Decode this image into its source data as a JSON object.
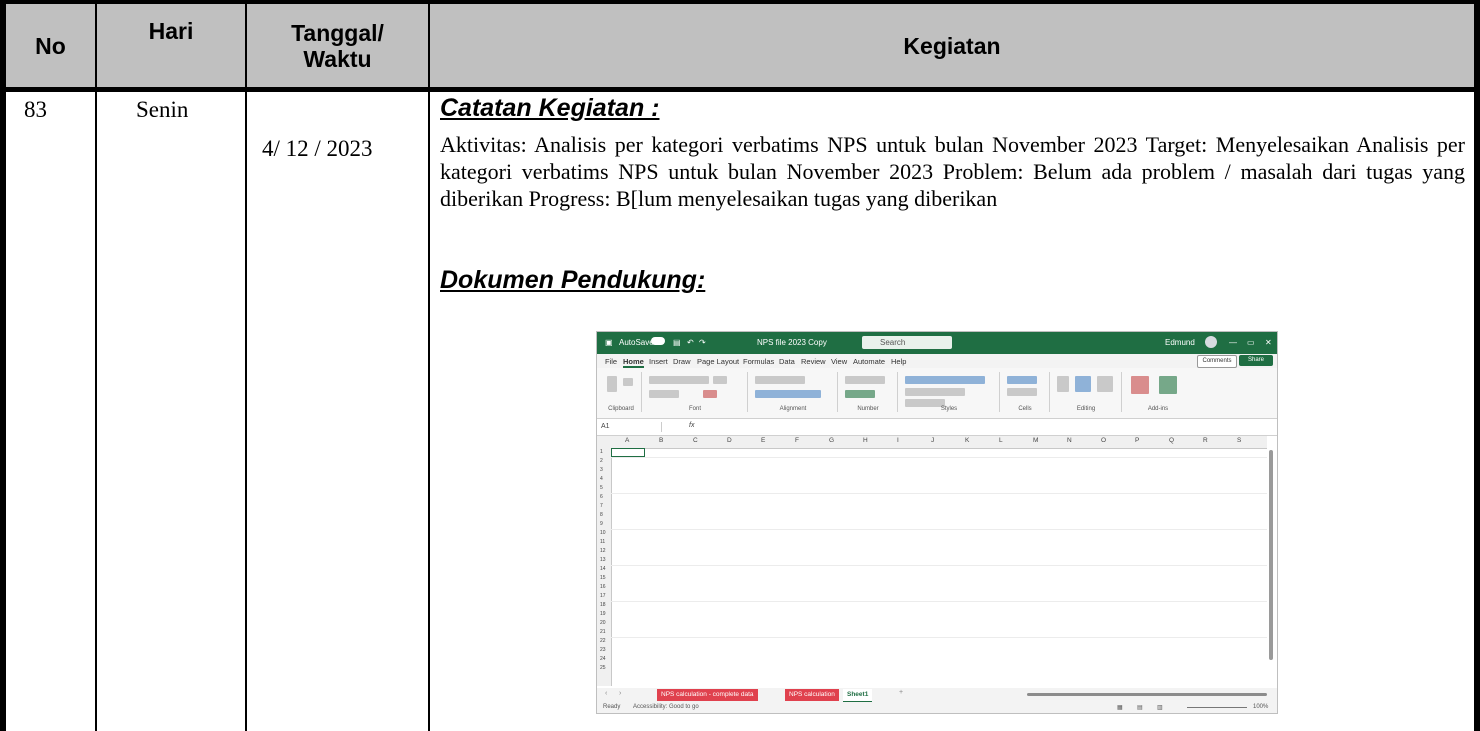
{
  "header": {
    "no": "No",
    "hari": "Hari",
    "tanggal": "Tanggal/",
    "waktu": "Waktu",
    "kegiatan": "Kegiatan"
  },
  "entry": {
    "no": "83",
    "hari": "Senin",
    "tanggal": "4/ 12 / 2023",
    "catatan_heading": "Catatan Kegiatan :",
    "catatan_body": "Aktivitas: Analisis per kategori verbatims NPS untuk bulan November 2023 Target: Menyelesaikan Analisis per kategori verbatims NPS untuk bulan November 2023 Problem: Belum ada problem / masalah dari tugas yang diberikan Progress: B[lum menyelesaikan tugas yang diberikan",
    "dokumen_heading": "Dokumen Pendukung:"
  },
  "screenshot": {
    "autosave": "AutoSave",
    "filename": "NPS file 2023 Copy",
    "search": "Search",
    "user": "Edmund",
    "menu": [
      "File",
      "Home",
      "Insert",
      "Draw",
      "Page Layout",
      "Formulas",
      "Data",
      "Review",
      "View",
      "Automate",
      "Help"
    ],
    "comments": "Comments",
    "share": "Share",
    "ribbon_groups": [
      "Clipboard",
      "Font",
      "Alignment",
      "Number",
      "Styles",
      "Cells",
      "Editing",
      "Add-ins"
    ],
    "namebox": "A1",
    "fx": "fx",
    "columns": [
      "A",
      "B",
      "C",
      "D",
      "E",
      "F",
      "G",
      "H",
      "I",
      "J",
      "K",
      "L",
      "M",
      "N",
      "O",
      "P",
      "Q",
      "R",
      "S"
    ],
    "rows": [
      "1",
      "2",
      "3",
      "4",
      "5",
      "6",
      "7",
      "8",
      "9",
      "10",
      "11",
      "12",
      "13",
      "14",
      "15",
      "16",
      "17",
      "18",
      "19",
      "20",
      "21",
      "22",
      "23",
      "24",
      "25"
    ],
    "tabs": [
      "NPS calculation - complete data",
      "NPS calculation",
      "Sheet1"
    ],
    "status_ready": "Ready",
    "status_accessibility": "Accessibility: Good to go",
    "zoom": "100%"
  }
}
